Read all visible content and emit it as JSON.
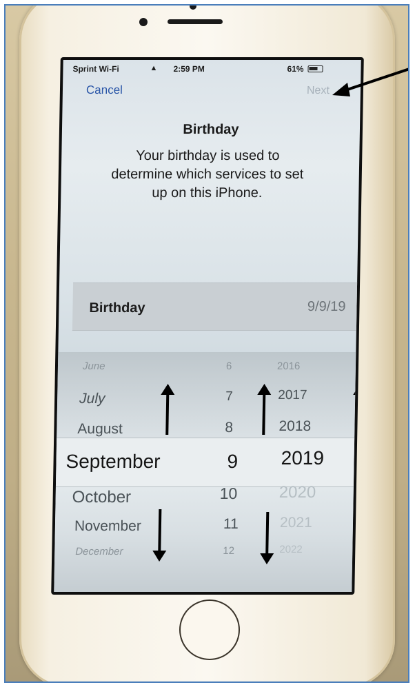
{
  "status_bar": {
    "carrier": "Sprint Wi-Fi",
    "time": "2:59 PM",
    "battery": "61%"
  },
  "nav": {
    "cancel_label": "Cancel",
    "next_label": "Next"
  },
  "page": {
    "title": "Birthday",
    "description": "Your birthday is used to determine which services to set up on this iPhone."
  },
  "birthday_row": {
    "label": "Birthday",
    "value": "9/9/19"
  },
  "picker": {
    "months": [
      "June",
      "July",
      "August",
      "September",
      "October",
      "November",
      "December"
    ],
    "days": [
      "6",
      "7",
      "8",
      "9",
      "10",
      "11",
      "12"
    ],
    "years": [
      "2016",
      "2017",
      "2018",
      "2019",
      "2020",
      "2021",
      "2022"
    ],
    "selected_month": "September",
    "selected_day": "9",
    "selected_year": "2019"
  },
  "colors": {
    "accent": "#2a56a8",
    "disabled": "#a8b2bb",
    "frame_border": "#4a7ebb"
  }
}
